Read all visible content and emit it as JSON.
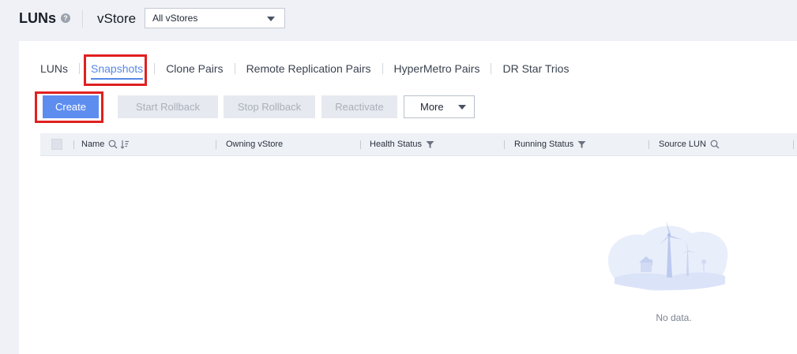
{
  "header": {
    "title": "LUNs",
    "help_icon": "question-circle-icon",
    "vstore_label": "vStore",
    "vstore_select": {
      "value": "All vStores",
      "caret_icon": "chevron-down-icon"
    }
  },
  "tabs": [
    {
      "label": "LUNs",
      "active": false
    },
    {
      "label": "Snapshots",
      "active": true
    },
    {
      "label": "Clone Pairs",
      "active": false
    },
    {
      "label": "Remote Replication Pairs",
      "active": false
    },
    {
      "label": "HyperMetro Pairs",
      "active": false
    },
    {
      "label": "DR Star Trios",
      "active": false
    }
  ],
  "toolbar": {
    "create": "Create",
    "start_rollback": "Start Rollback",
    "stop_rollback": "Stop Rollback",
    "reactivate": "Reactivate",
    "more": "More"
  },
  "table": {
    "columns": [
      {
        "label": "Name",
        "icons": [
          "search-icon",
          "sort-icon"
        ]
      },
      {
        "label": "Owning vStore",
        "icons": []
      },
      {
        "label": "Health Status",
        "icons": [
          "filter-icon"
        ]
      },
      {
        "label": "Running Status",
        "icons": [
          "filter-icon"
        ]
      },
      {
        "label": "Source LUN",
        "icons": [
          "search-icon"
        ]
      }
    ],
    "empty_text": "No data."
  },
  "colors": {
    "accent": "#5688e8",
    "primary_button": "#5e8df0",
    "highlight_box": "#e02020",
    "disabled_button_bg": "#e6e9ef",
    "disabled_button_text": "#a9b0bb"
  }
}
